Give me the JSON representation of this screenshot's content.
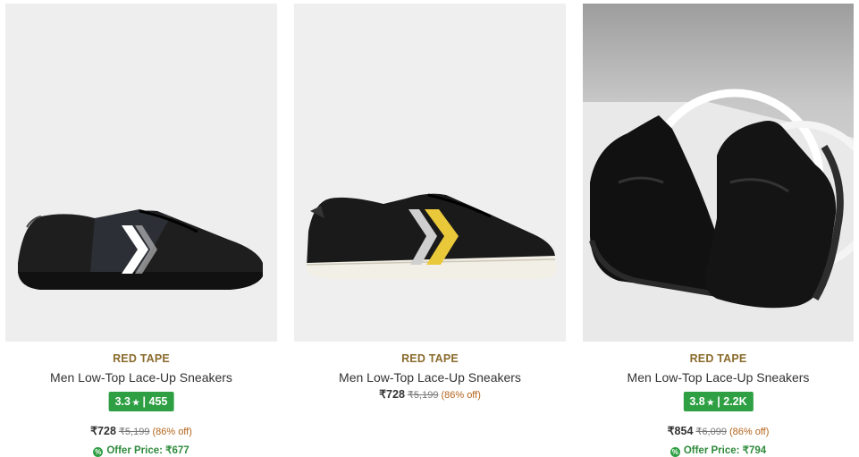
{
  "products": [
    {
      "brand": "RED TAPE",
      "name": "Men Low-Top Lace-Up Sneakers",
      "rating": "3.3",
      "rating_count": "455",
      "price": "₹728",
      "mrp": "₹5,199",
      "discount": "(86% off)",
      "offer_price": "Offer Price: ₹677",
      "image_bg": "#efeeee"
    },
    {
      "brand": "RED TAPE",
      "name": "Men Low-Top Lace-Up Sneakers",
      "price": "₹728",
      "mrp": "₹5,199",
      "discount": "(86% off)",
      "image_bg": "#efefef",
      "accent": "#e9c93a"
    },
    {
      "brand": "RED TAPE",
      "name": "Men Low-Top Lace-Up Sneakers",
      "rating": "3.8",
      "rating_count": "2.2K",
      "price": "₹854",
      "mrp": "₹6,099",
      "discount": "(86% off)",
      "offer_price": "Offer Price: ₹794",
      "image_bg": "#d9d9d9"
    }
  ],
  "colors": {
    "brand": "#8a6b2c",
    "rating_bg": "#2ea043",
    "offer": "#2f8a3c"
  },
  "icons": {
    "star": "star-icon",
    "offer": "percent-badge-icon"
  }
}
